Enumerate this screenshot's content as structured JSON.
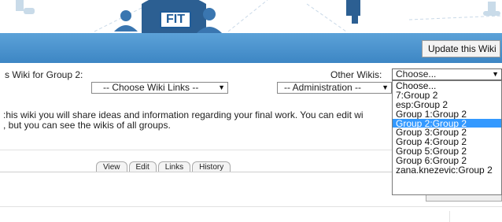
{
  "banner": {
    "logo_text": "FIT"
  },
  "toolbar": {
    "update_button": "Update this Wiki"
  },
  "header": {
    "wiki_for": "s Wiki for Group 2:",
    "other_wikis_label": "Other Wikis:",
    "links_select": "-- Choose Wiki Links --",
    "admin_select": "-- Administration --",
    "other_select": "Choose..."
  },
  "description": {
    "line1": ":his wiki you will share ideas and information regarding your final work. You can edit wi",
    "line2": ", but you can see the wikis of all groups."
  },
  "tabs": {
    "view": "View",
    "edit": "Edit",
    "links": "Links",
    "history": "History"
  },
  "dropdown": {
    "options": [
      "Choose...",
      "7:Group 2",
      "esp:Group 2",
      "Group 1:Group 2",
      "Group 2:Group 2",
      "Group 3:Group 2",
      "Group 4:Group 2",
      "Group 5:Group 2",
      "Group 6:Group 2",
      "zana.knezevic:Group 2"
    ],
    "selected": "Group 2:Group 2"
  },
  "colors": {
    "toolbar": "#4a92cc",
    "selection": "#3399ff",
    "logo": "#1f5c99"
  }
}
